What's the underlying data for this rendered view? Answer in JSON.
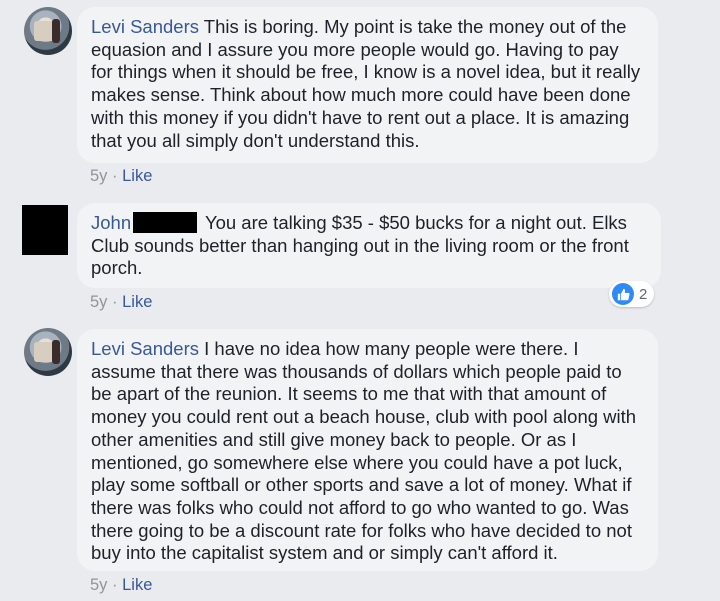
{
  "comments": [
    {
      "author": "Levi Sanders",
      "text": "This is boring. My point is take the money out of the equasion and I assure you more people would go. Having to pay for things when it should be free, I know is a novel idea, but it really makes sense. Think about how much more could have been done with this money if you didn't have to rent out a place. It is amazing that you all simply don't understand this.",
      "age": "5y",
      "separator": "·",
      "like_label": "Like"
    },
    {
      "author": "John",
      "text": "You are talking $35 - $50 bucks for a night out. Elks Club sounds better than hanging out in the living room or the front porch.",
      "age": "5y",
      "separator": "·",
      "like_label": "Like",
      "reaction_count": "2",
      "reaction_icon": "thumbs-up-icon",
      "reaction_color": "#2e8af6"
    },
    {
      "author": "Levi Sanders",
      "text": "I have no idea how many people were there. I assume that there was thousands of dollars which people paid to be apart of the reunion. It seems to me that with that amount of money you could rent out a beach house, club with pool along with other amenities and still give money back to people. Or as I mentioned, go somewhere else where you could have a pot luck, play some softball or other sports and save a lot of money. What if there was folks who could not afford to go who wanted to go. Was there going to be a discount rate for folks who have decided to not buy into the capitalist system and or simply can't afford it.",
      "age": "5y",
      "separator": "·",
      "like_label": "Like"
    }
  ],
  "colors": {
    "background": "#e9ebee",
    "bubble": "#f2f3f5",
    "author_link": "#385898",
    "meta_text": "#90949c"
  }
}
